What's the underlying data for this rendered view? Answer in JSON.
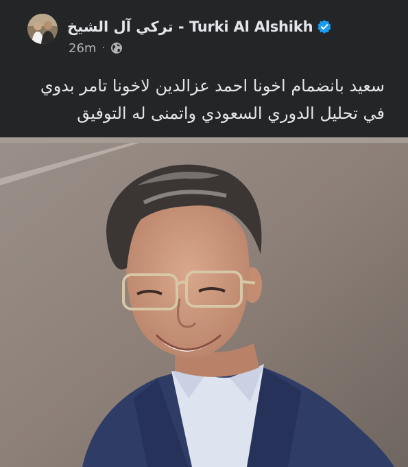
{
  "post": {
    "author": "تركي آل الشيخ - Turki Al Alshikh",
    "timestamp": "26m",
    "separator": "·",
    "audience_icon": "globe-icon",
    "verified_icon": "verified-badge-icon",
    "text_lines": [
      "سعيد بانضمام اخونا احمد عزالدين لاخونا تامر بدوي",
      "في تحليل الدوري السعودي واتمنى له التوفيق"
    ]
  },
  "colors": {
    "background": "#242526",
    "text_primary": "#e4e6eb",
    "text_secondary": "#b0b3b8",
    "verified_blue": "#1d9bf0"
  }
}
